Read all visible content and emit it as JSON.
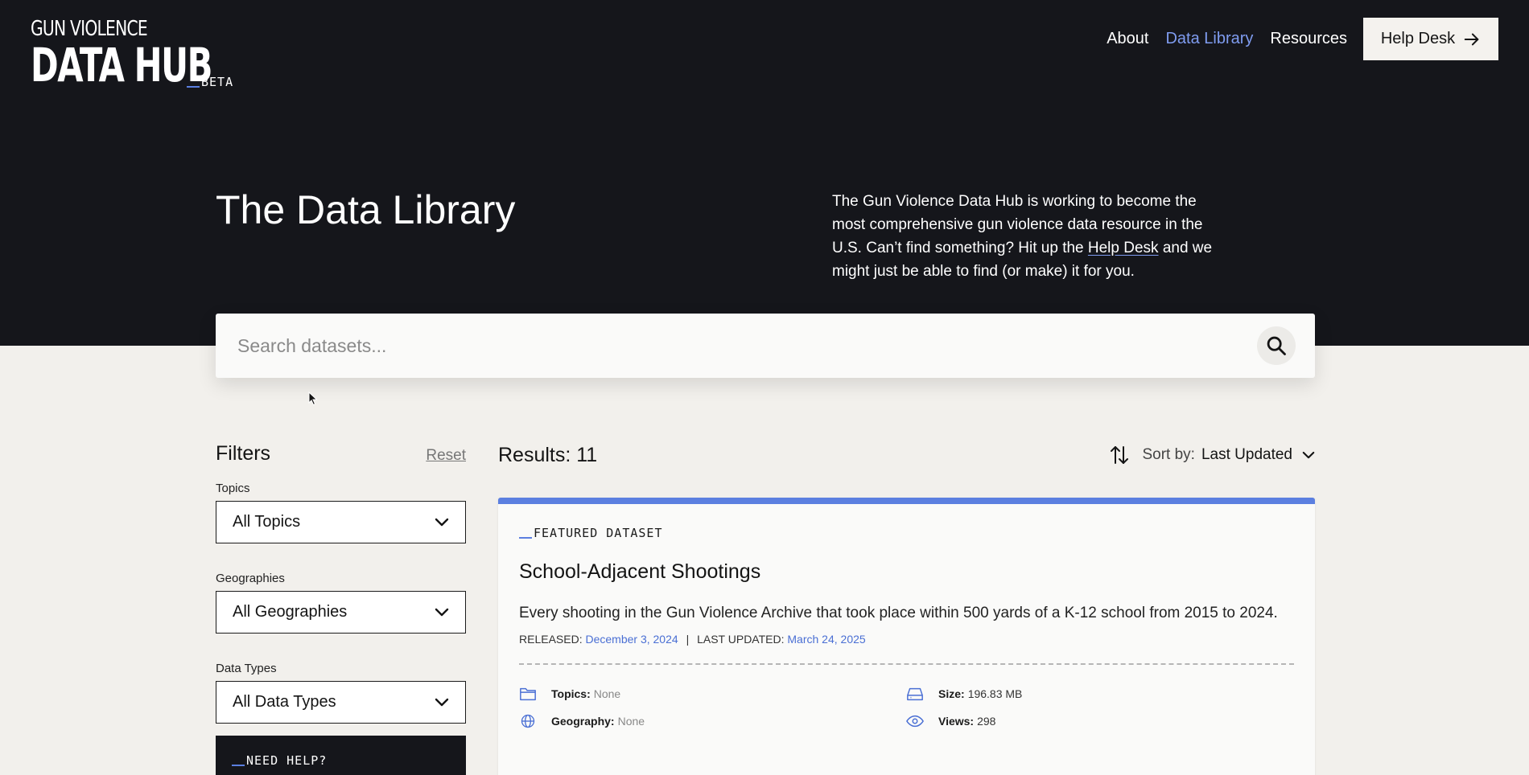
{
  "header": {
    "logo_line1": "GUN VIOLENCE",
    "logo_line2": "DATA HUB",
    "beta": "BETA",
    "nav": [
      "About",
      "Data Library",
      "Resources"
    ],
    "active_nav": "Data Library",
    "help_desk": "Help Desk",
    "accent_color": "#7f9cf0"
  },
  "hero": {
    "title": "The Data Library",
    "intro_before": "The Gun Violence Data Hub is working to become the most comprehensive gun violence data resource in the U.S. Can’t find something? Hit up the ",
    "intro_link": "Help Desk",
    "intro_after": " and we might just be able to find (or make) it for you."
  },
  "search": {
    "placeholder": "Search datasets...",
    "icon": "search-icon"
  },
  "filters": {
    "title": "Filters",
    "reset": "Reset",
    "topics_label": "Topics",
    "topics_value": "All Topics",
    "geographies_label": "Geographies",
    "geographies_value": "All Geographies",
    "data_types_label": "Data Types",
    "data_types_value": "All Data Types",
    "help_title": "NEED HELP?"
  },
  "results": {
    "count_label": "Results: 11",
    "sort_label": "Sort by:",
    "sort_value": "Last Updated"
  },
  "card": {
    "badge": "FEATURED DATASET",
    "title": "School-Adjacent Shootings",
    "description": "Every shooting in the Gun Violence Archive that took place within 500 yards of a K-12 school from 2015 to 2024.",
    "released_label": "RELEASED:",
    "released": "December 3, 2024",
    "separator": "|",
    "updated_label": "LAST UPDATED:",
    "updated": "March 24, 2025",
    "topics_label": "Topics:",
    "topics": "None",
    "geography_label": "Geography:",
    "geography": "None",
    "size_label": "Size:",
    "size": "196.83 MB",
    "views_label": "Views:",
    "views": "298",
    "accent_color": "#5b7fe0"
  }
}
